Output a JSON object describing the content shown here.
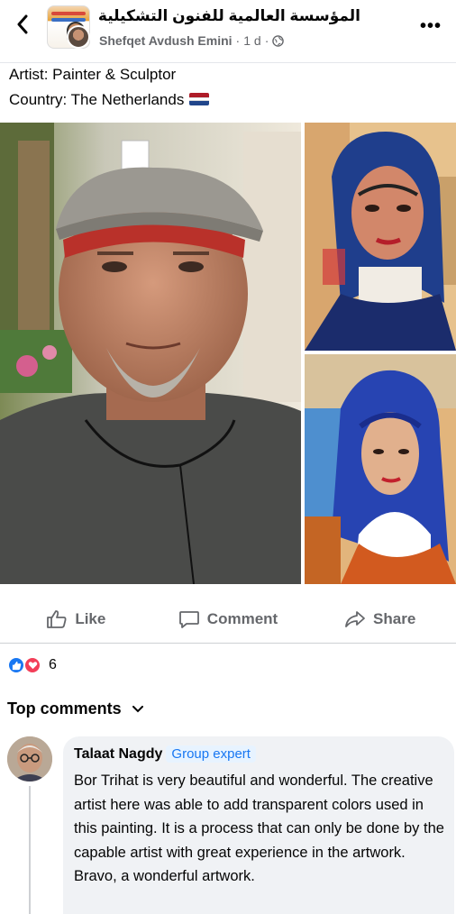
{
  "header": {
    "group_name": "المؤسسة العالمية للفنون التشكيلية",
    "author": "Shefqet Avdush Emini",
    "time": "1 d",
    "separator": "·",
    "more": "•••"
  },
  "post": {
    "line1": "Artist: Painter & Sculptor",
    "line2": "Country: The Netherlands",
    "flag_colors": [
      "#ae1c28",
      "#ffffff",
      "#21468b"
    ]
  },
  "actions": {
    "like": "Like",
    "comment": "Comment",
    "share": "Share"
  },
  "reactions": {
    "count": "6"
  },
  "comments": {
    "toggle_label": "Top comments",
    "items": [
      {
        "name": "Talaat Nagdy",
        "badge": "Group expert",
        "text": "Bor Trihat is very beautiful and wonderful. The creative artist here was able to add transparent colors used in this painting. It is a process that can only be done by the capable artist with great experience in the artwork. Bravo, a wonderful artwork."
      }
    ]
  },
  "colors": {
    "accent": "#1877f2",
    "love": "#f33e58",
    "muted": "#65676b"
  }
}
